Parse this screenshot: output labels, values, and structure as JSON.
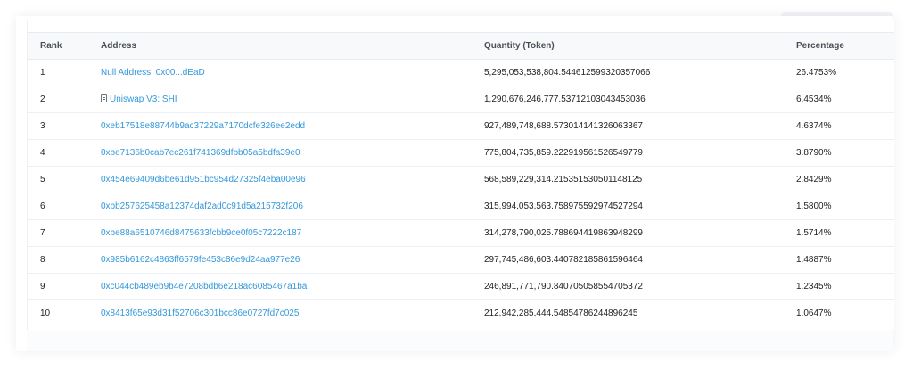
{
  "table": {
    "headers": {
      "rank": "Rank",
      "address": "Address",
      "quantity": "Quantity (Token)",
      "percentage": "Percentage"
    },
    "rows": [
      {
        "rank": "1",
        "address": "Null Address: 0x00...dEaD",
        "is_contract": false,
        "quantity": "5,295,053,538,804.544612599320357066",
        "percentage": "26.4753%"
      },
      {
        "rank": "2",
        "address": "Uniswap V3: SHI",
        "is_contract": true,
        "quantity": "1,290,676,246,777.53712103043453036",
        "percentage": "6.4534%"
      },
      {
        "rank": "3",
        "address": "0xeb17518e88744b9ac37229a7170dcfe326ee2edd",
        "is_contract": false,
        "quantity": "927,489,748,688.573014141326063367",
        "percentage": "4.6374%"
      },
      {
        "rank": "4",
        "address": "0xbe7136b0cab7ec261f741369dfbb05a5bdfa39e0",
        "is_contract": false,
        "quantity": "775,804,735,859.222919561526549779",
        "percentage": "3.8790%"
      },
      {
        "rank": "5",
        "address": "0x454e69409d6be61d951bc954d27325f4eba00e96",
        "is_contract": false,
        "quantity": "568,589,229,314.215351530501148125",
        "percentage": "2.8429%"
      },
      {
        "rank": "6",
        "address": "0xbb257625458a12374daf2ad0c91d5a215732f206",
        "is_contract": false,
        "quantity": "315,994,053,563.758975592974527294",
        "percentage": "1.5800%"
      },
      {
        "rank": "7",
        "address": "0xbe88a6510746d8475633fcbb9ce0f05c7222c187",
        "is_contract": false,
        "quantity": "314,278,790,025.788694419863948299",
        "percentage": "1.5714%"
      },
      {
        "rank": "8",
        "address": "0x985b6162c4863ff6579fe453c86e9d24aa977e26",
        "is_contract": false,
        "quantity": "297,745,486,603.440782185861596464",
        "percentage": "1.4887%"
      },
      {
        "rank": "9",
        "address": "0xc044cb489eb9b4e7208bdb6e218ac6085467a1ba",
        "is_contract": false,
        "quantity": "246,891,771,790.840705058554705372",
        "percentage": "1.2345%"
      },
      {
        "rank": "10",
        "address": "0x8413f65e93d31f52706c301bcc86e0727fd7c025",
        "is_contract": false,
        "quantity": "212,942,285,444.54854786244896245",
        "percentage": "1.0647%"
      }
    ]
  },
  "colors": {
    "link": "#3498db",
    "text": "#1e2022",
    "header_bg": "#f8f9fb",
    "border": "#e7eaf3"
  }
}
